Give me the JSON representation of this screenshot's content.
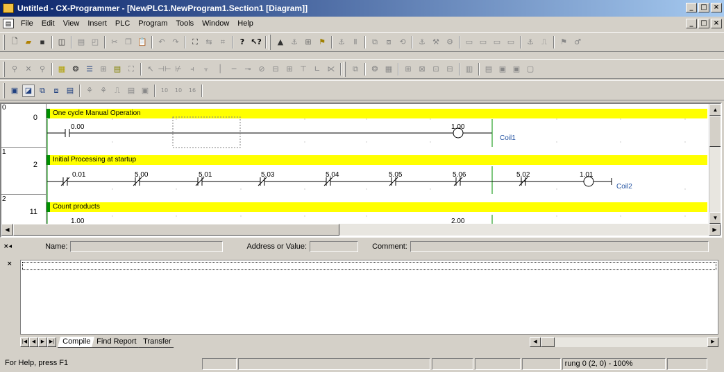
{
  "window": {
    "title": "Untitled - CX-Programmer - [NewPLC1.NewProgram1.Section1 [Diagram]]"
  },
  "caption_buttons": {
    "minimize": "_",
    "maximize": "□",
    "close": "×"
  },
  "menu": [
    "File",
    "Edit",
    "View",
    "Insert",
    "PLC",
    "Program",
    "Tools",
    "Window",
    "Help"
  ],
  "toolbar_icons": {
    "row1": [
      "new-icon",
      "open-icon",
      "save-icon",
      "preview-icon",
      "print-icon",
      "print-preview-icon",
      "cut-icon",
      "copy-icon",
      "paste-icon",
      "undo-icon",
      "redo-icon",
      "find-icon",
      "replace-icon",
      "address-icon",
      "help-icon",
      "context-help-icon",
      "online-icon",
      "monitor-icon",
      "transfer-icon",
      "compare-icon",
      "pause-icon",
      "program-mode-icon",
      "debug-mode-icon",
      "monitor-mode-icon",
      "run-icon",
      "differential-icon",
      "force-on-icon",
      "force-off-icon",
      "set-value-icon",
      "io-table-icon",
      "setup-icon"
    ],
    "row2": [
      "zoom-in-icon",
      "zoom-out-icon",
      "zoom-icon",
      "grid-icon",
      "symbol-icon",
      "list-icon",
      "comment-icon",
      "rung-comment-icon",
      "window-icon",
      "select-icon",
      "contact-no-icon",
      "contact-nc-icon",
      "or-no-icon",
      "or-nc-icon",
      "vertical-icon",
      "horizontal-icon",
      "coil-no-icon",
      "coil-nc-icon",
      "instruction-icon",
      "instruction2-icon",
      "function-block-icon",
      "pfb-icon",
      "iil-icon",
      "compile-icon",
      "online-edit-icon",
      "online-edit-cancel-icon",
      "transfer-changes-icon",
      "undo-edit-icon",
      "cross-ref-icon",
      "watch-icon",
      "memory-icon",
      "table-icon"
    ],
    "row3": [
      "project-window-icon",
      "output-window-icon",
      "watch-window-icon",
      "address-ref-icon",
      "properties-icon",
      "cross-ref-report-icon",
      "data-trace-icon",
      "time-chart-icon",
      "memory-card-icon",
      "io-icon"
    ],
    "row3_numbers": [
      "10",
      "10",
      "16"
    ]
  },
  "diagram": {
    "rungs": [
      {
        "rung": "0",
        "step": "0",
        "comment": "One cycle Manual Operation"
      },
      {
        "rung": "1",
        "step": "2",
        "comment": "Initial Processing at startup"
      },
      {
        "rung": "2",
        "step": "11",
        "comment": "Count products"
      }
    ],
    "rung0": {
      "contact": "0.00",
      "coil": "1.00",
      "coil_name": "Coil1"
    },
    "rung1": {
      "contacts": [
        "0.01",
        "5.00",
        "5.01",
        "5.03",
        "5.04",
        "5.05",
        "5.06",
        "5.02"
      ],
      "coil": "1.01",
      "coil_name": "Coil2"
    },
    "rung2": {
      "contact": "1.00",
      "coil": "2.00"
    }
  },
  "infobar": {
    "name_label": "Name:",
    "address_label": "Address or Value:",
    "comment_label": "Comment:"
  },
  "output_tabs": [
    "Compile",
    "Find Report",
    "Transfer"
  ],
  "status": {
    "help": "For Help, press F1",
    "position": "rung 0 (2, 0)  - 100%"
  }
}
